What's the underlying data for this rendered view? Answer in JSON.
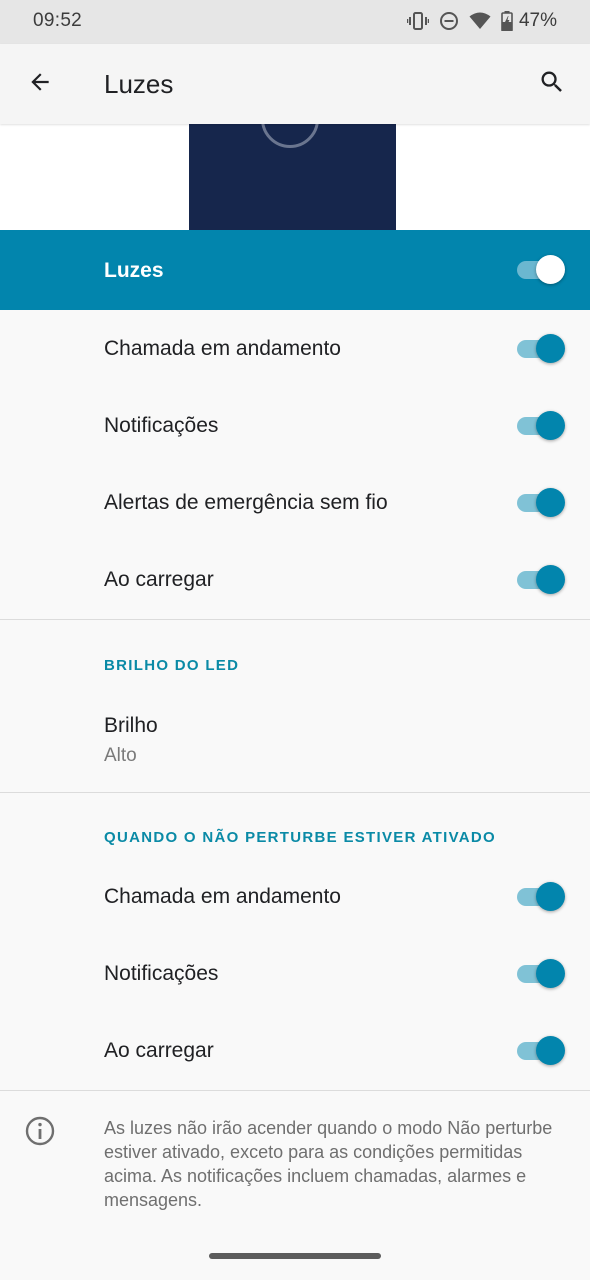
{
  "status_bar": {
    "time": "09:52",
    "battery_percent": "47%",
    "icons": [
      "vibrate-icon",
      "do-not-disturb-icon",
      "wifi-icon",
      "battery-charging-icon"
    ]
  },
  "app_bar": {
    "title": "Luzes",
    "back_icon": "arrow-back-icon",
    "search_icon": "search-icon"
  },
  "master_toggle": {
    "label": "Luzes",
    "on": true
  },
  "lights_items": [
    {
      "label": "Chamada em andamento",
      "on": true
    },
    {
      "label": "Notificações",
      "on": true
    },
    {
      "label": "Alertas de emergência sem fio",
      "on": true
    },
    {
      "label": "Ao carregar",
      "on": true
    }
  ],
  "led_section": {
    "header": "BRILHO DO LED",
    "brightness_title": "Brilho",
    "brightness_value": "Alto"
  },
  "dnd_section": {
    "header": "QUANDO O NÃO PERTURBE ESTIVER ATIVADO",
    "items": [
      {
        "label": "Chamada em andamento",
        "on": true
      },
      {
        "label": "Notificações",
        "on": true
      },
      {
        "label": "Ao carregar",
        "on": true
      }
    ]
  },
  "footer": {
    "info_icon": "info-icon",
    "text": "As luzes não irão acender quando o modo Não perturbe estiver ativado, exceto para as condições permitidas acima. As notificações incluem chamadas, alarmes e mensagens."
  },
  "colors": {
    "accent": "#0285ad",
    "accent_track": "#80c2d6",
    "section_header": "#0a8aa6",
    "preview_screen": "#16264c"
  }
}
